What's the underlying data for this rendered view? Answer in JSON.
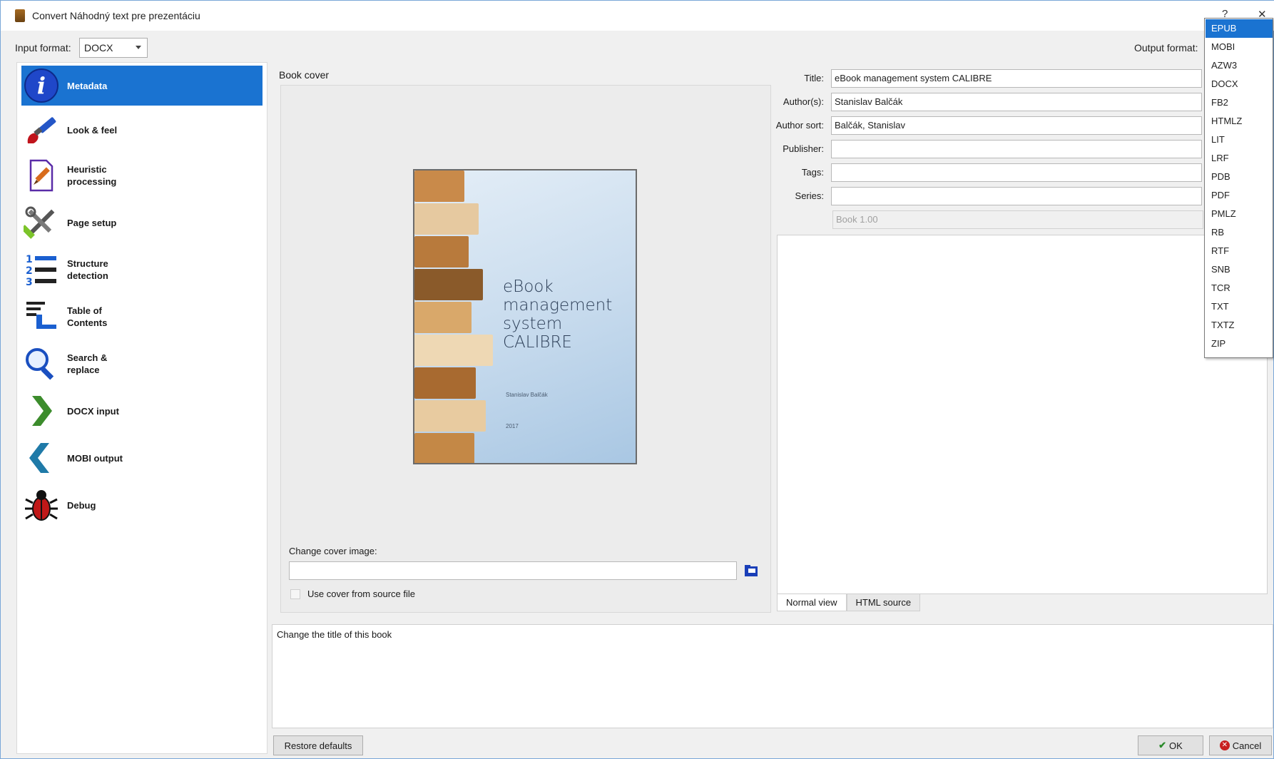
{
  "window": {
    "title": "Convert Náhodný text pre prezentáciu",
    "help": "?",
    "close": "✕"
  },
  "input_format": {
    "label": "Input format:",
    "value": "DOCX"
  },
  "output_format": {
    "label": "Output format:"
  },
  "sidebar": {
    "items": [
      {
        "label1": "Metadata",
        "label2": "",
        "icon": "info-icon"
      },
      {
        "label1": "Look & feel",
        "label2": "",
        "icon": "paintbrush-icon"
      },
      {
        "label1": "Heuristic",
        "label2": "processing",
        "icon": "document-pencil-icon"
      },
      {
        "label1": "Page setup",
        "label2": "",
        "icon": "tools-icon"
      },
      {
        "label1": "Structure",
        "label2": "detection",
        "icon": "numbered-list-icon"
      },
      {
        "label1": "Table of",
        "label2": "Contents",
        "icon": "toc-icon"
      },
      {
        "label1": "Search &",
        "label2": "replace",
        "icon": "magnifier-icon"
      },
      {
        "label1": "DOCX input",
        "label2": "",
        "icon": "arrow-right-icon"
      },
      {
        "label1": "MOBI output",
        "label2": "",
        "icon": "arrow-left-icon"
      },
      {
        "label1": "Debug",
        "label2": "",
        "icon": "bug-icon"
      }
    ]
  },
  "cover": {
    "label": "Book cover",
    "line1": "eBook",
    "line2": "management",
    "line3": "system",
    "line4": "CALIBRE",
    "author": "Stanislav Balčák",
    "year": "2017",
    "change_label": "Change cover image:",
    "use_source_label": "Use cover from source file"
  },
  "fields": {
    "title_label": "Title:",
    "title_value": "eBook management system CALIBRE",
    "authors_label": "Author(s):",
    "authors_value": "Stanislav Balčák",
    "author_sort_label": "Author sort:",
    "author_sort_value": "Balčák, Stanislav",
    "publisher_label": "Publisher:",
    "publisher_value": "",
    "tags_label": "Tags:",
    "tags_value": "",
    "series_label": "Series:",
    "series_value": "",
    "book_number": "Book 1.00"
  },
  "editor_tabs": {
    "normal": "Normal view",
    "html": "HTML source"
  },
  "help_text": "Change the title of this book",
  "buttons": {
    "restore": "Restore defaults",
    "ok": "OK",
    "cancel": "Cancel"
  },
  "dropdown": {
    "options": [
      "EPUB",
      "MOBI",
      "AZW3",
      "DOCX",
      "FB2",
      "HTMLZ",
      "LIT",
      "LRF",
      "PDB",
      "PDF",
      "PMLZ",
      "RB",
      "RTF",
      "SNB",
      "TCR",
      "TXT",
      "TXTZ",
      "ZIP"
    ],
    "selected": "EPUB"
  },
  "colors": {
    "accent": "#1a73d1"
  }
}
